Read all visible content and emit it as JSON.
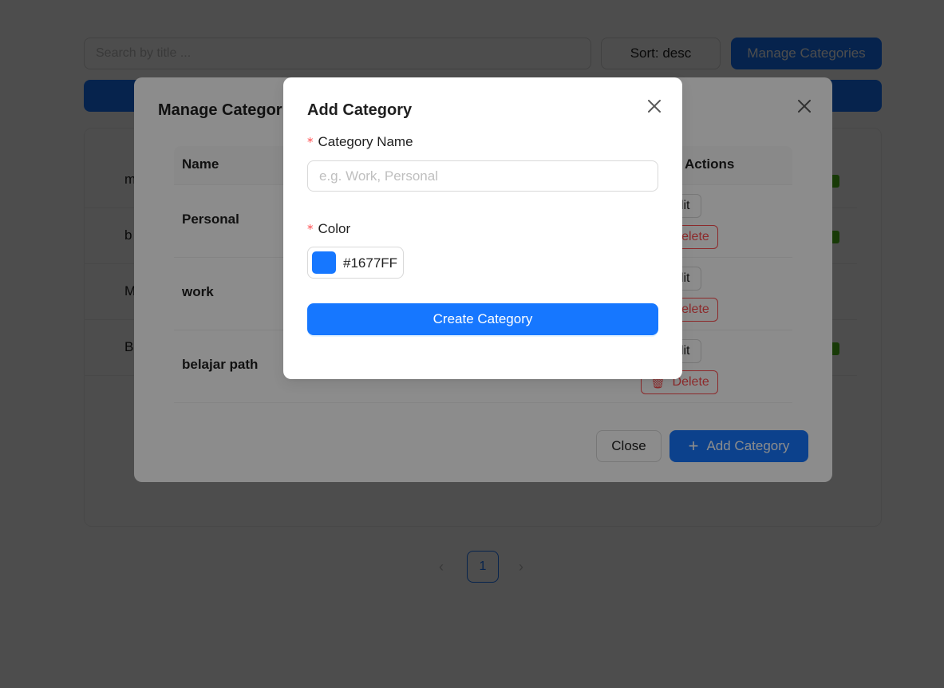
{
  "toolbar": {
    "search_placeholder": "Search by title ...",
    "sort_label": "Sort: desc",
    "manage_categories_label": "Manage Categories"
  },
  "todo_list": {
    "rows": [
      {
        "title_fragment": "m"
      },
      {
        "title_fragment": "b"
      },
      {
        "title_fragment": "M"
      },
      {
        "title_fragment": "B"
      }
    ]
  },
  "pagination": {
    "current_page": "1",
    "prev_icon": "chevron-left-icon",
    "next_icon": "chevron-right-icon"
  },
  "manage_modal": {
    "title": "Manage Categories",
    "table": {
      "column_name": "Name",
      "column_actions": "Actions",
      "rows": [
        {
          "name": "Personal",
          "edit_label": "Edit",
          "delete_label": "Delete"
        },
        {
          "name": "work",
          "edit_label": "Edit",
          "delete_label": "Delete"
        },
        {
          "name": "belajar path",
          "edit_label": "Edit",
          "delete_label": "Delete"
        }
      ]
    },
    "close_label": "Close",
    "add_label": "Add Category"
  },
  "add_modal": {
    "title": "Add Category",
    "name_label": "Category Name",
    "name_placeholder": "e.g. Work, Personal",
    "name_value": "",
    "color_label": "Color",
    "color_value": "#1677FF",
    "submit_label": "Create Category"
  },
  "colors": {
    "primary": "#1677ff",
    "danger": "#ff4d4f",
    "success": "#52c41a"
  }
}
